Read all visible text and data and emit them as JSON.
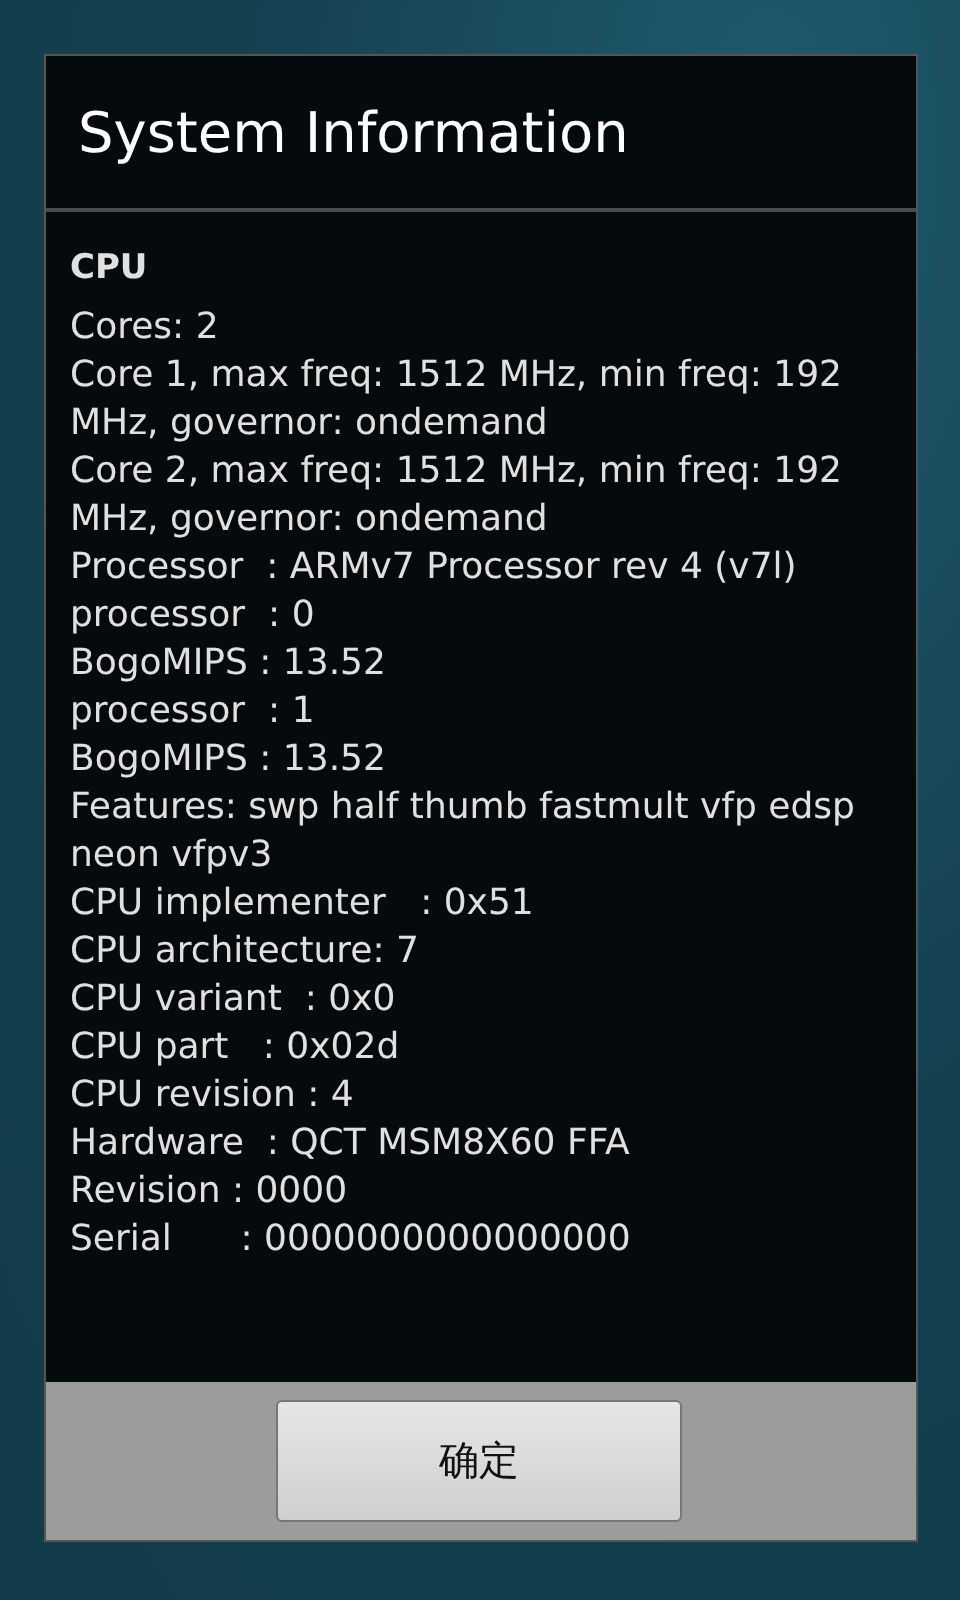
{
  "dialog": {
    "title": "System Information",
    "section_heading": "CPU",
    "lines": [
      "Cores: 2",
      "Core 1, max freq: 1512 MHz, min freq: 192 MHz, governor: ondemand",
      "Core 2, max freq: 1512 MHz, min freq: 192 MHz, governor: ondemand",
      "Processor  : ARMv7 Processor rev 4 (v7l)",
      "processor  : 0",
      "BogoMIPS : 13.52",
      "processor  : 1",
      "BogoMIPS : 13.52",
      "Features: swp half thumb fastmult vfp edsp neon vfpv3",
      "CPU implementer   : 0x51",
      "CPU architecture: 7",
      "CPU variant  : 0x0",
      "CPU part   : 0x02d",
      "CPU revision : 4",
      "Hardware  : QCT MSM8X60 FFA",
      "Revision : 0000",
      "Serial      : 0000000000000000"
    ],
    "buttons": [
      "确定"
    ]
  }
}
